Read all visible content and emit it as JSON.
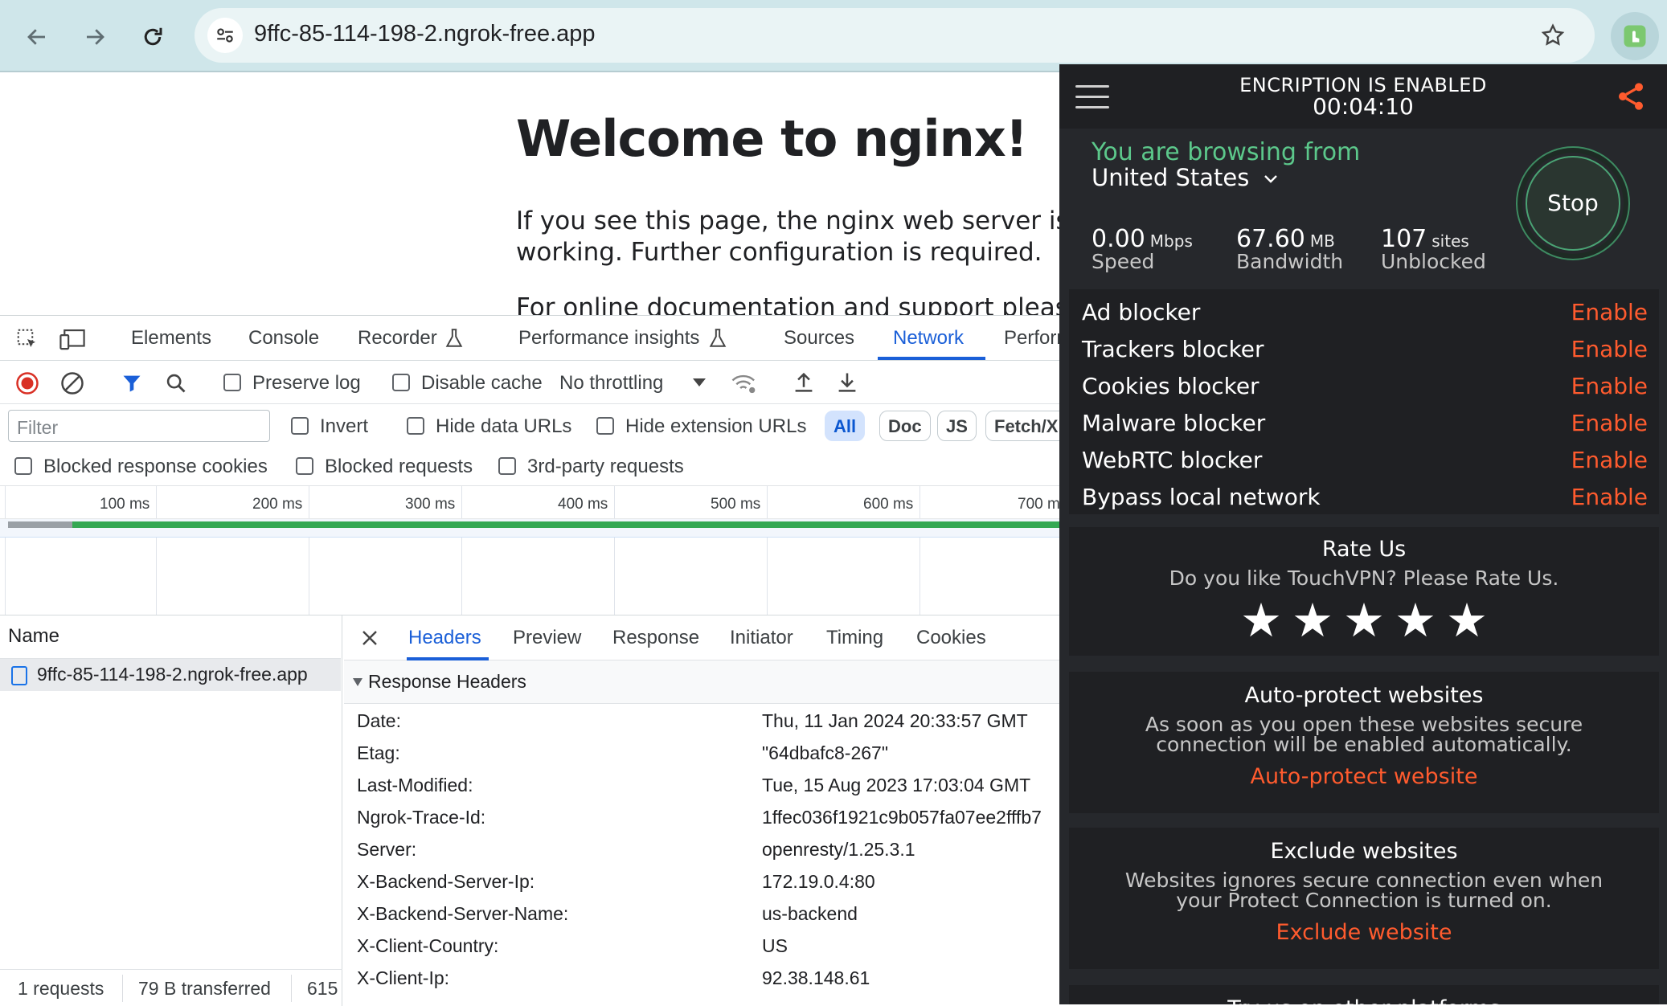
{
  "browser": {
    "url": "9ffc-85-114-198-2.ngrok-free.app"
  },
  "page": {
    "heading": "Welcome to nginx!",
    "para1_line1": "If you see this page, the nginx web server is su",
    "para1_line2": "working. Further configuration is required.",
    "para2_line1": "For online documentation and support please re"
  },
  "devtools": {
    "tabs": [
      "Elements",
      "Console",
      "Recorder",
      "Performance insights",
      "Sources",
      "Network",
      "Perforn"
    ],
    "active_tab": "Network",
    "controls": {
      "preserve_log": "Preserve log",
      "disable_cache": "Disable cache",
      "throttling": "No throttling"
    },
    "filter": {
      "placeholder": "Filter",
      "invert": "Invert",
      "hide_data_urls": "Hide data URLs",
      "hide_extension_urls": "Hide extension URLs",
      "chips": [
        "All",
        "Doc",
        "JS",
        "Fetch/X"
      ]
    },
    "blocked": {
      "cookies": "Blocked response cookies",
      "requests": "Blocked requests",
      "third_party": "3rd-party requests"
    },
    "timeline_ticks": [
      "100 ms",
      "200 ms",
      "300 ms",
      "400 ms",
      "500 ms",
      "600 ms",
      "700 m"
    ],
    "name_header": "Name",
    "request_name": "9ffc-85-114-198-2.ngrok-free.app",
    "status": {
      "requests": "1 requests",
      "transferred": "79 B transferred",
      "resources": "615"
    },
    "detail_tabs": [
      "Headers",
      "Preview",
      "Response",
      "Initiator",
      "Timing",
      "Cookies"
    ],
    "response_headers_title": "Response Headers",
    "headers": [
      {
        "key": "Date:",
        "value": "Thu, 11 Jan 2024 20:33:57 GMT"
      },
      {
        "key": "Etag:",
        "value": "\"64dbafc8-267\""
      },
      {
        "key": "Last-Modified:",
        "value": "Tue, 15 Aug 2023 17:03:04 GMT"
      },
      {
        "key": "Ngrok-Trace-Id:",
        "value": "1ffec036f1921c9b057fa07ee2fffb7"
      },
      {
        "key": "Server:",
        "value": "openresty/1.25.3.1"
      },
      {
        "key": "X-Backend-Server-Ip:",
        "value": "172.19.0.4:80"
      },
      {
        "key": "X-Backend-Server-Name:",
        "value": "us-backend"
      },
      {
        "key": "X-Client-Country:",
        "value": "US"
      },
      {
        "key": "X-Client-Ip:",
        "value": "92.38.148.61"
      }
    ]
  },
  "vpn": {
    "title": "ENCRIPTION IS ENABLED",
    "timer": "00:04:10",
    "browsing_from": "You are browsing from",
    "country": "United States",
    "stop": "Stop",
    "stats": [
      {
        "value": "0.00",
        "unit": "Mbps",
        "label": "Speed"
      },
      {
        "value": "67.60",
        "unit": "MB",
        "label": "Bandwidth"
      },
      {
        "value": "107",
        "unit": "sites",
        "label": "Unblocked"
      }
    ],
    "features": [
      {
        "name": "Ad blocker",
        "action": "Enable"
      },
      {
        "name": "Trackers blocker",
        "action": "Enable"
      },
      {
        "name": "Cookies blocker",
        "action": "Enable"
      },
      {
        "name": "Malware blocker",
        "action": "Enable"
      },
      {
        "name": "WebRTC blocker",
        "action": "Enable"
      },
      {
        "name": "Bypass local network",
        "action": "Enable"
      }
    ],
    "rate": {
      "title": "Rate Us",
      "text": "Do you like TouchVPN? Please Rate Us."
    },
    "auto_protect": {
      "title": "Auto-protect websites",
      "text_line1": "As soon as you open these websites secure",
      "text_line2": "connection will be enabled automatically.",
      "link": "Auto-protect website"
    },
    "exclude": {
      "title": "Exclude websites",
      "text_line1": "Websites ignores secure connection even when",
      "text_line2": "your Protect Connection is turned on.",
      "link": "Exclude website"
    },
    "bottom_partial": "Try us on other platforms"
  },
  "colors": {
    "accent_blue": "#1a5fd8",
    "vpn_green": "#5cc88b",
    "vpn_orange": "#ff5b2e",
    "vpn_bg": "#26282c"
  }
}
